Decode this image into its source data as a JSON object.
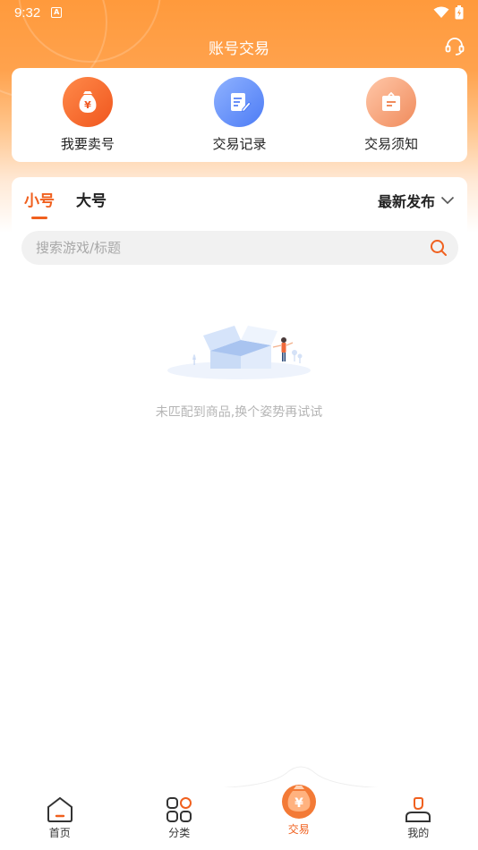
{
  "status_bar": {
    "time": "9:32",
    "a_icon": "A"
  },
  "header": {
    "title": "账号交易"
  },
  "quick_actions": [
    {
      "label": "我要卖号",
      "icon": "money-bag-icon"
    },
    {
      "label": "交易记录",
      "icon": "document-edit-icon"
    },
    {
      "label": "交易须知",
      "icon": "notice-box-icon"
    }
  ],
  "tabs": [
    {
      "label": "小号",
      "active": true
    },
    {
      "label": "大号",
      "active": false
    }
  ],
  "sort": {
    "label": "最新发布"
  },
  "search": {
    "placeholder": "搜索游戏/标题",
    "value": ""
  },
  "empty_state": {
    "message": "未匹配到商品,换个姿势再试试"
  },
  "bottom_nav": [
    {
      "label": "首页",
      "icon": "home-icon"
    },
    {
      "label": "分类",
      "icon": "category-icon"
    },
    {
      "label": "交易",
      "icon": "trade-icon",
      "active": true
    },
    {
      "label": "我的",
      "icon": "profile-icon"
    }
  ],
  "colors": {
    "accent": "#f0601e",
    "header_gradient_top": "#ff9a3c",
    "blue": "#4d7cf5"
  }
}
